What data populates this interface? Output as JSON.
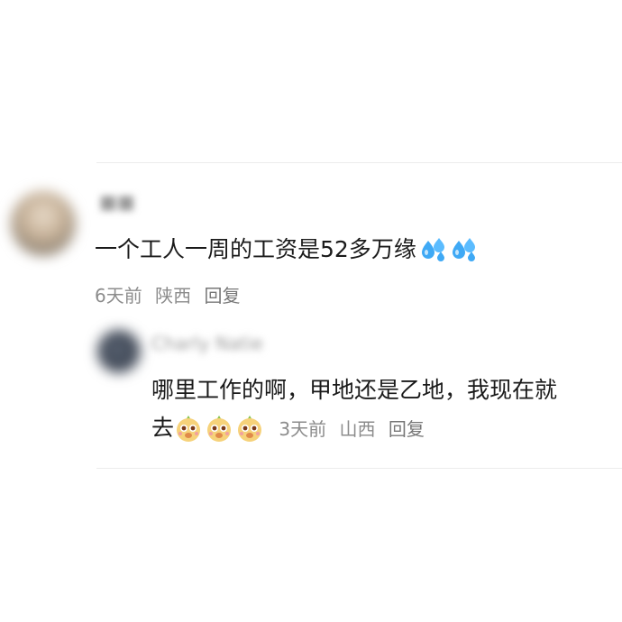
{
  "comment": {
    "text": "一个工人一周的工资是52多万缘",
    "emojis": [
      "sweat-drops-icon",
      "sweat-drops-icon"
    ],
    "time": "6天前",
    "location": "陕西",
    "reply_label": "回复"
  },
  "reply": {
    "username": "Charly Natie",
    "text_line1": "哪里工作的啊，甲地还是乙地，我现在就",
    "text_line2": "去",
    "emojis": [
      "meerkat-face-icon",
      "meerkat-face-icon",
      "meerkat-face-icon"
    ],
    "time": "3天前",
    "location": "山西",
    "reply_label": "回复"
  },
  "colors": {
    "text": "#1a1a1a",
    "meta": "#8c8c8c",
    "divider": "#ececec",
    "sweat_blue": "#3fa9f5"
  }
}
